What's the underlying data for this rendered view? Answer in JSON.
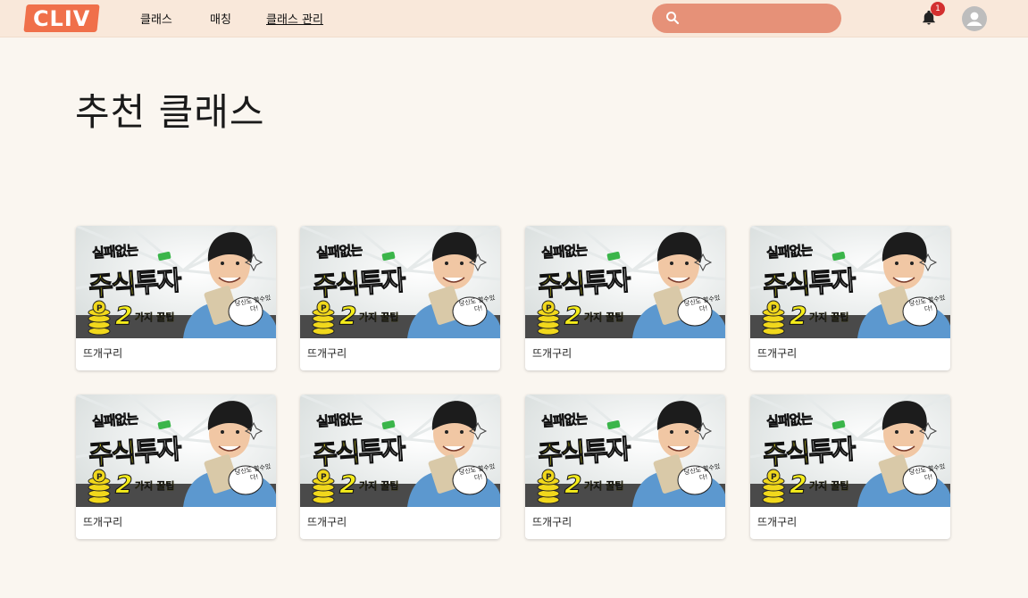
{
  "header": {
    "logo": "CLIV",
    "nav": [
      {
        "label": "클래스"
      },
      {
        "label": "매칭"
      },
      {
        "label": "클래스 관리"
      }
    ],
    "search": {
      "value": "",
      "placeholder": ""
    },
    "notifications": {
      "count": "1"
    },
    "icons": {
      "search": "search-icon",
      "bell": "bell-icon",
      "account": "account-circle-icon"
    },
    "colors": {
      "topbar": "#f9e8da",
      "logo": "#f0704a",
      "search": "#e69178",
      "badge": "#d32f2f"
    }
  },
  "main": {
    "title": "추천 클래스",
    "thumbnail": {
      "line1": "실패없는",
      "line2a": "주식",
      "line2b": "투자",
      "number": "2",
      "tip": "가지 꿀팁",
      "bubble": "당신도 할수있다!"
    },
    "cards": [
      {
        "label": "뜨개구리"
      },
      {
        "label": "뜨개구리"
      },
      {
        "label": "뜨개구리"
      },
      {
        "label": "뜨개구리"
      },
      {
        "label": "뜨개구리"
      },
      {
        "label": "뜨개구리"
      },
      {
        "label": "뜨개구리"
      },
      {
        "label": "뜨개구리"
      }
    ]
  }
}
